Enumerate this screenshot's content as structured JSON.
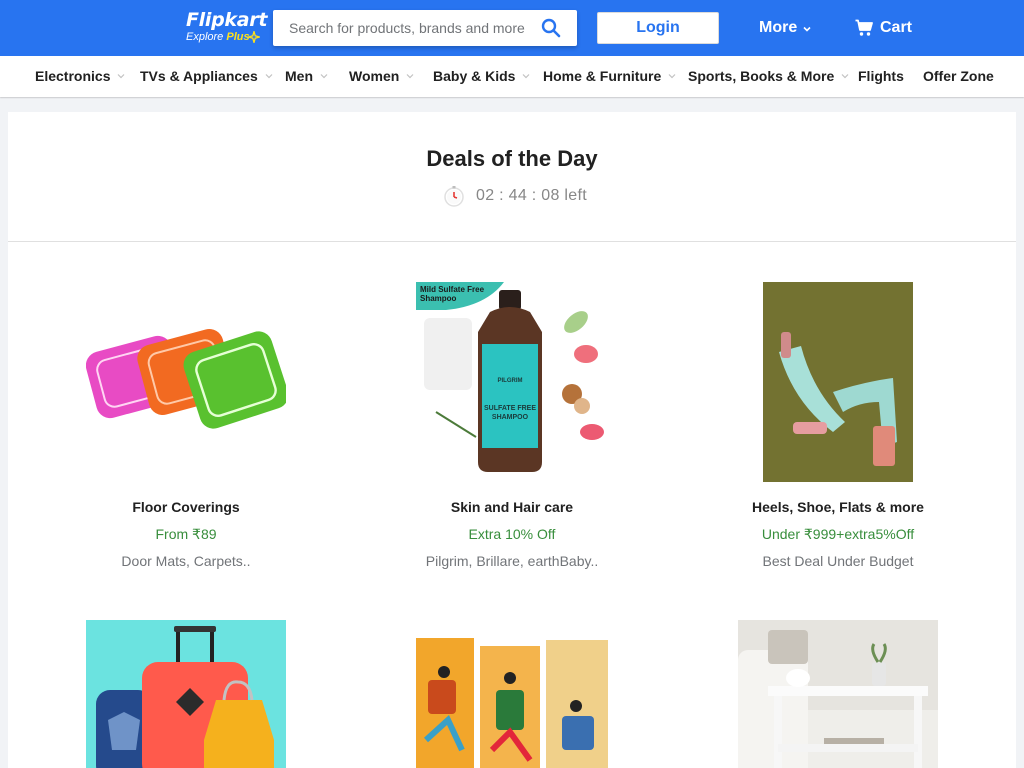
{
  "header": {
    "logo_text": "Flipkart",
    "logo_sub_prefix": "Explore",
    "logo_sub_plus": "Plus",
    "search_placeholder": "Search for products, brands and more",
    "login_label": "Login",
    "more_label": "More",
    "cart_label": "Cart",
    "brand_color": "#2874f0",
    "plus_color": "#ffe11b"
  },
  "categories": [
    {
      "label": "Electronics",
      "has_dropdown": true
    },
    {
      "label": "TVs & Appliances",
      "has_dropdown": true
    },
    {
      "label": "Men",
      "has_dropdown": true
    },
    {
      "label": "Women",
      "has_dropdown": true
    },
    {
      "label": "Baby & Kids",
      "has_dropdown": true
    },
    {
      "label": "Home & Furniture",
      "has_dropdown": true
    },
    {
      "label": "Sports, Books & More",
      "has_dropdown": true
    },
    {
      "label": "Flights",
      "has_dropdown": false
    },
    {
      "label": "Offer Zone",
      "has_dropdown": false
    }
  ],
  "deals": {
    "title": "Deals of the Day",
    "timer": "02 : 44 : 08  left",
    "offer_color": "#388e3c",
    "items": [
      {
        "name": "Floor Coverings",
        "offer": "From ₹89",
        "subtitle": "Door Mats, Carpets..",
        "image": "floor-mats-image"
      },
      {
        "name": "Skin and Hair care",
        "offer": "Extra 10% Off",
        "subtitle": "Pilgrim, Brillare, earthBaby..",
        "image": "shampoo-bottle-image",
        "badge": "Mild Sulfate Free Shampoo",
        "bottle_text": "SULFATE FREE SHAMPOO",
        "bottle_brand": "PILGRIM"
      },
      {
        "name": "Heels, Shoe, Flats & more",
        "offer": "Under ₹999+extra5%Off",
        "subtitle": "Best Deal Under Budget",
        "image": "block-heel-sandals-image"
      },
      {
        "name": "",
        "offer": "",
        "subtitle": "",
        "image": "luggage-bags-image"
      },
      {
        "name": "",
        "offer": "",
        "subtitle": "",
        "image": "tribal-art-paintings-image"
      },
      {
        "name": "",
        "offer": "",
        "subtitle": "",
        "image": "white-console-table-image"
      }
    ]
  }
}
